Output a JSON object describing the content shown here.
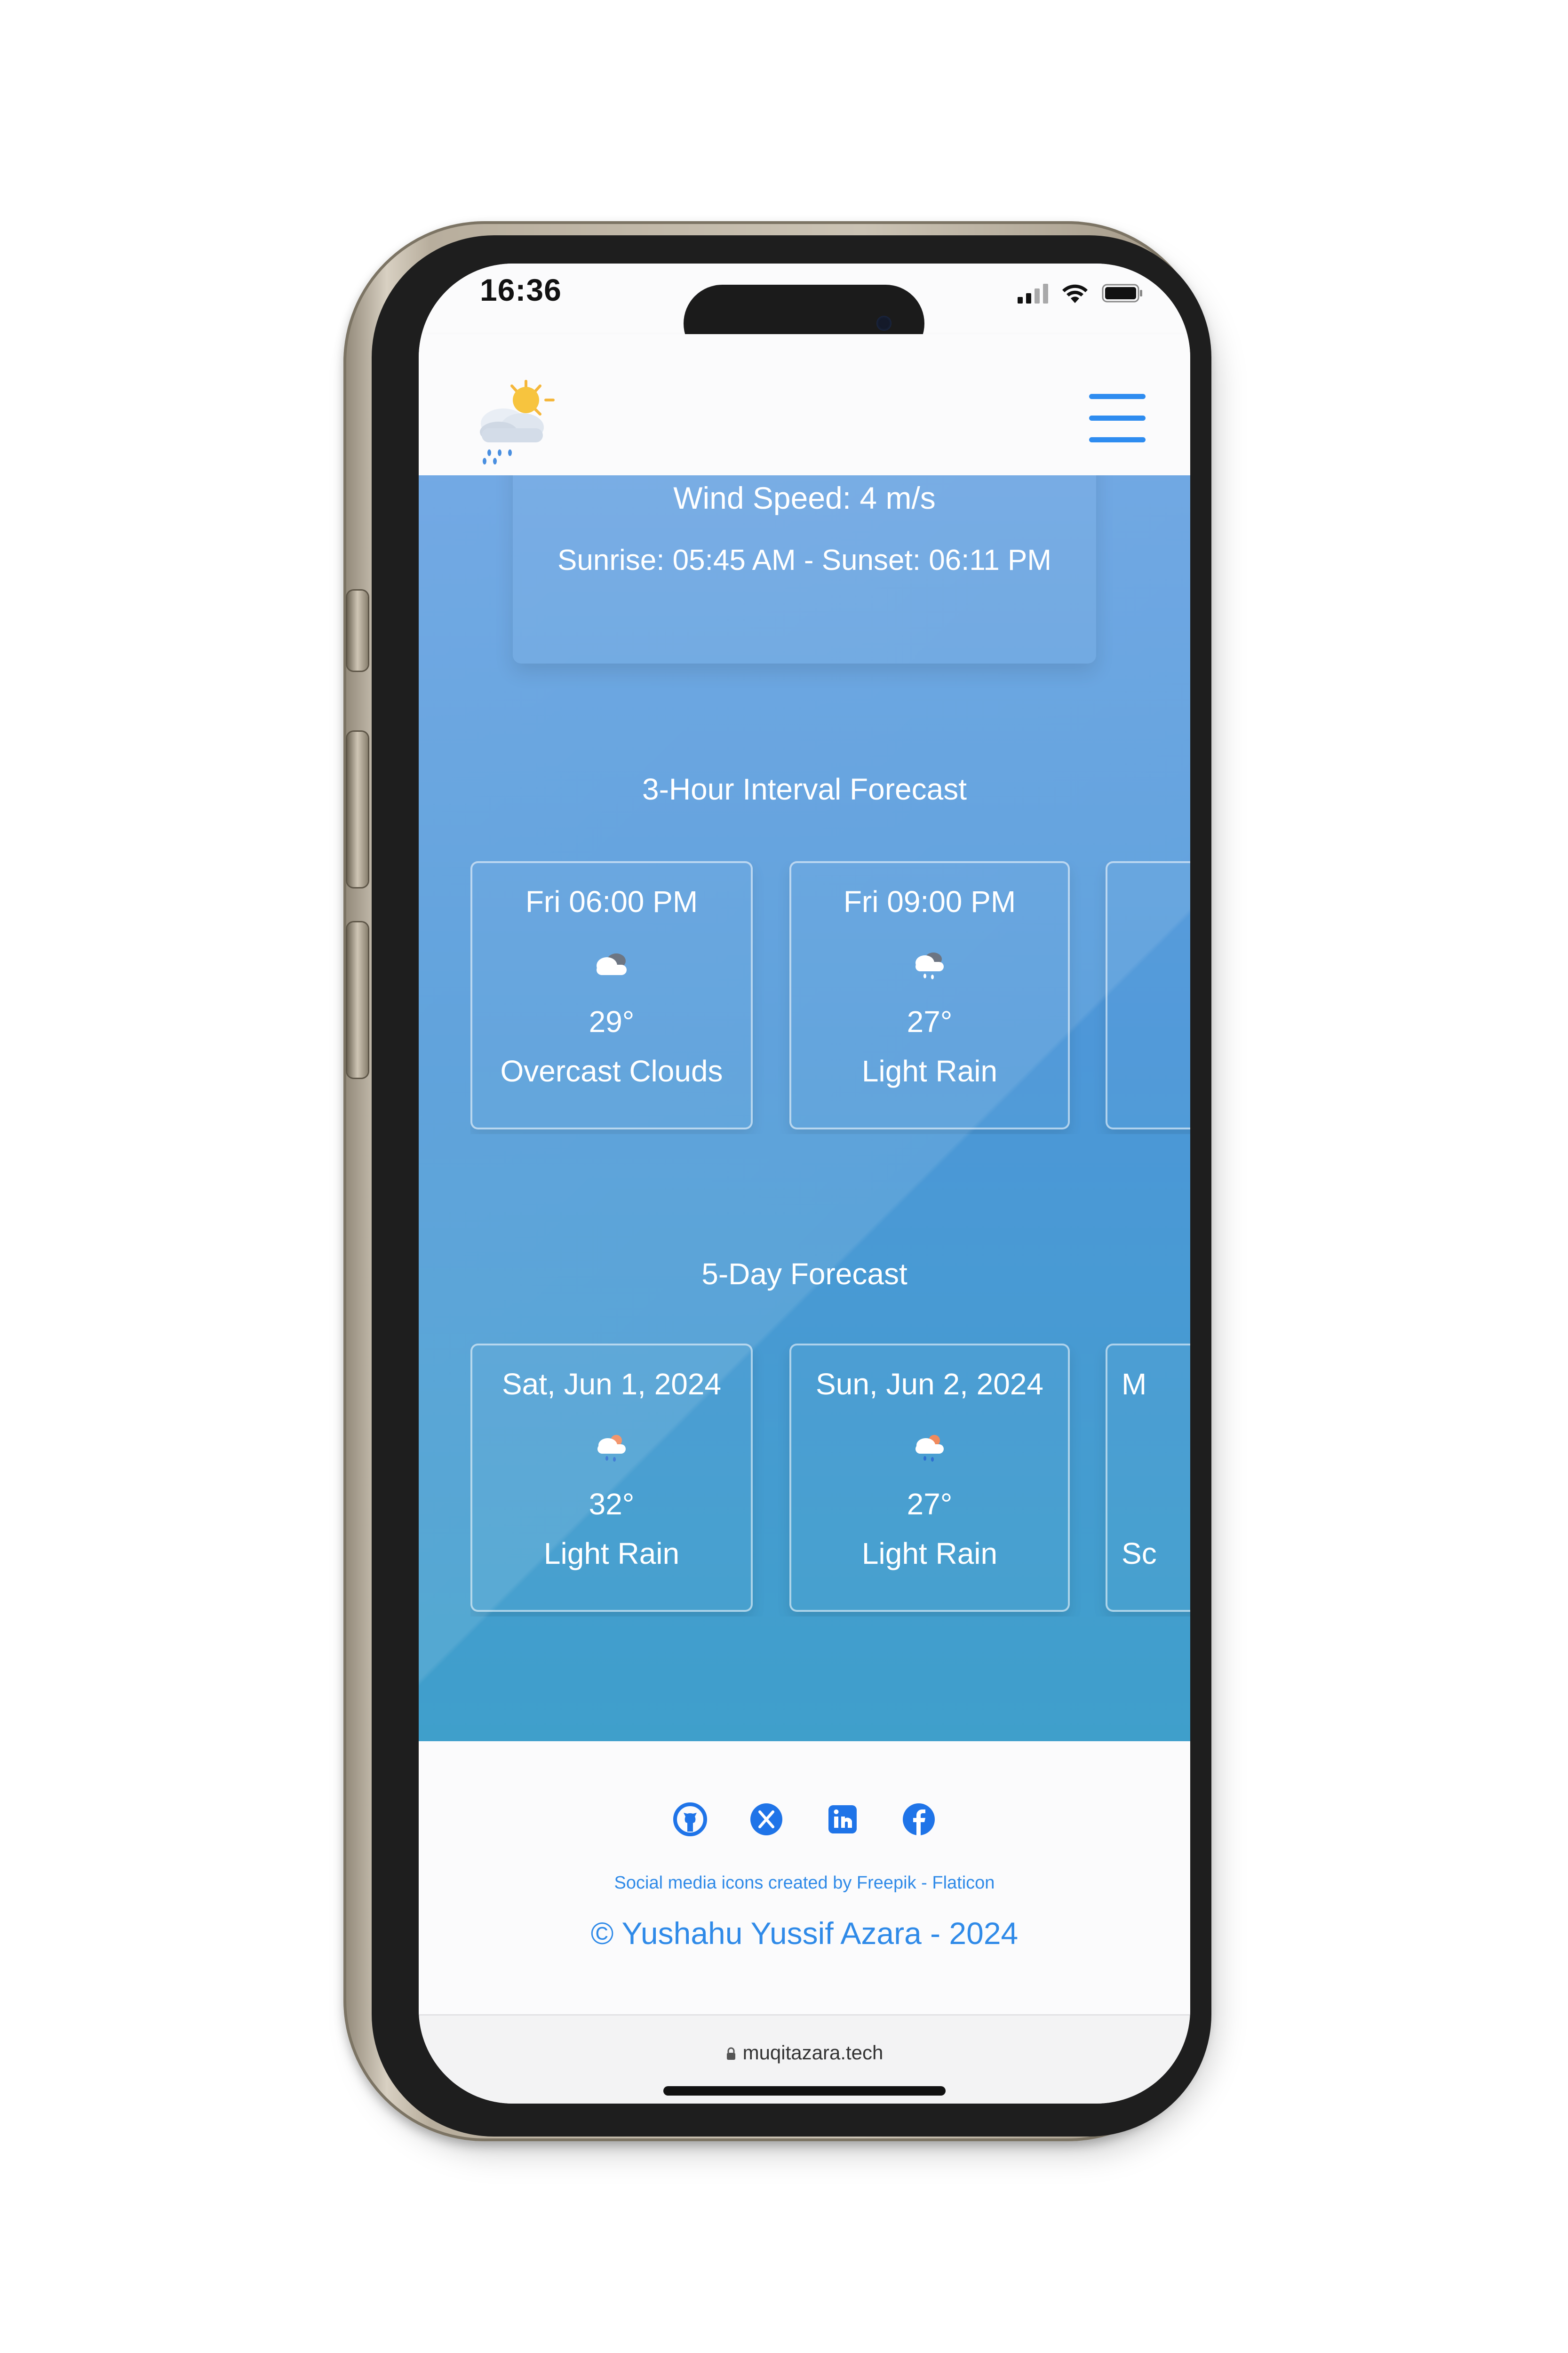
{
  "status_bar": {
    "time": "16:36",
    "icons": [
      "signal-icon",
      "wifi-icon",
      "battery-icon"
    ]
  },
  "header": {
    "logo_icon": "weather-logo-icon",
    "menu_icon": "hamburger-menu-icon"
  },
  "current": {
    "wind": "Wind Speed: 4 m/s",
    "sun": "Sunrise: 05:45 AM - Sunset: 06:11 PM"
  },
  "hourly": {
    "title": "3-Hour Interval Forecast",
    "items": [
      {
        "time": "Fri 06:00 PM",
        "icon": "overcast-clouds-icon",
        "temp": "29°",
        "desc": "Overcast Clouds"
      },
      {
        "time": "Fri 09:00 PM",
        "icon": "light-rain-icon",
        "temp": "27°",
        "desc": "Light Rain"
      }
    ]
  },
  "daily": {
    "title": "5-Day Forecast",
    "items": [
      {
        "date": "Sat, Jun 1, 2024",
        "icon": "light-rain-icon",
        "temp": "32°",
        "desc": "Light Rain"
      },
      {
        "date": "Sun, Jun 2, 2024",
        "icon": "light-rain-icon",
        "temp": "27°",
        "desc": "Light Rain"
      },
      {
        "date": "M",
        "desc": "Sc"
      }
    ]
  },
  "footer": {
    "social": [
      "github-icon",
      "x-twitter-icon",
      "linkedin-icon",
      "facebook-icon"
    ],
    "credit": "Social media icons created by Freepik - Flaticon",
    "copyright": "© Yushahu Yussif Azara - 2024"
  },
  "browser": {
    "url": "muqitazara.tech"
  },
  "colors": {
    "accent": "#2e8cf0",
    "main_bg_top": "#5f9de0",
    "main_bg_bottom": "#3f9fcb"
  }
}
